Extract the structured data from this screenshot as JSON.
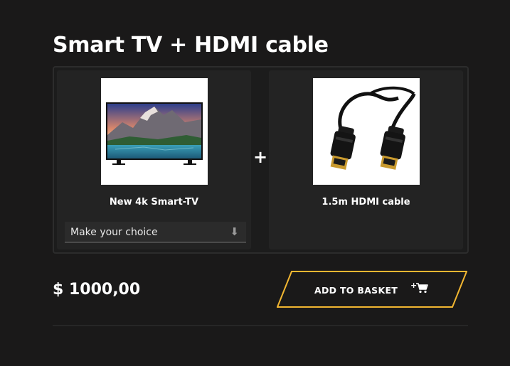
{
  "title": "Smart TV + HDMI cable",
  "products": [
    {
      "name": "New 4k Smart-TV",
      "image_icon": "smart-tv-image",
      "choice": {
        "value": "Make your choice",
        "arrow_icon": "down-arrow-icon"
      }
    },
    {
      "name": "1.5m HDMI cable",
      "image_icon": "hdmi-cable-image"
    }
  ],
  "combine_symbol": "+",
  "price": "$ 1000,00",
  "add_to_basket": {
    "label": "ADD TO BASKET",
    "icon": "add-to-cart-icon",
    "icon_prefix": "+"
  },
  "colors": {
    "background": "#1a1919",
    "card": "#232323",
    "accent": "#f2b631",
    "text": "#ffffff"
  }
}
